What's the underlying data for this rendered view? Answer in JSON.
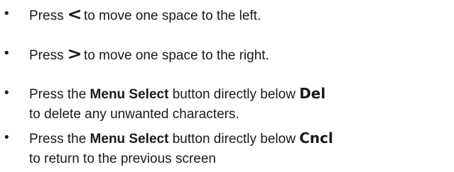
{
  "items": [
    {
      "bullet": "•",
      "prefix": "Press ",
      "symbol": "<",
      "suffix": "to move one space to the left."
    },
    {
      "bullet": "•",
      "prefix": "Press ",
      "symbol": ">",
      "suffix": "to move one space to the right."
    },
    {
      "bullet": "•",
      "prefix": "Press the ",
      "emphasis": "Menu Select",
      "middle": " button directly below ",
      "key": "Del",
      "line2": "to delete any unwanted characters."
    },
    {
      "bullet": "•",
      "prefix": "Press the ",
      "emphasis": "Menu Select",
      "middle": " button directly below ",
      "key": "Cncl",
      "line2": "to return to the previous screen"
    }
  ]
}
